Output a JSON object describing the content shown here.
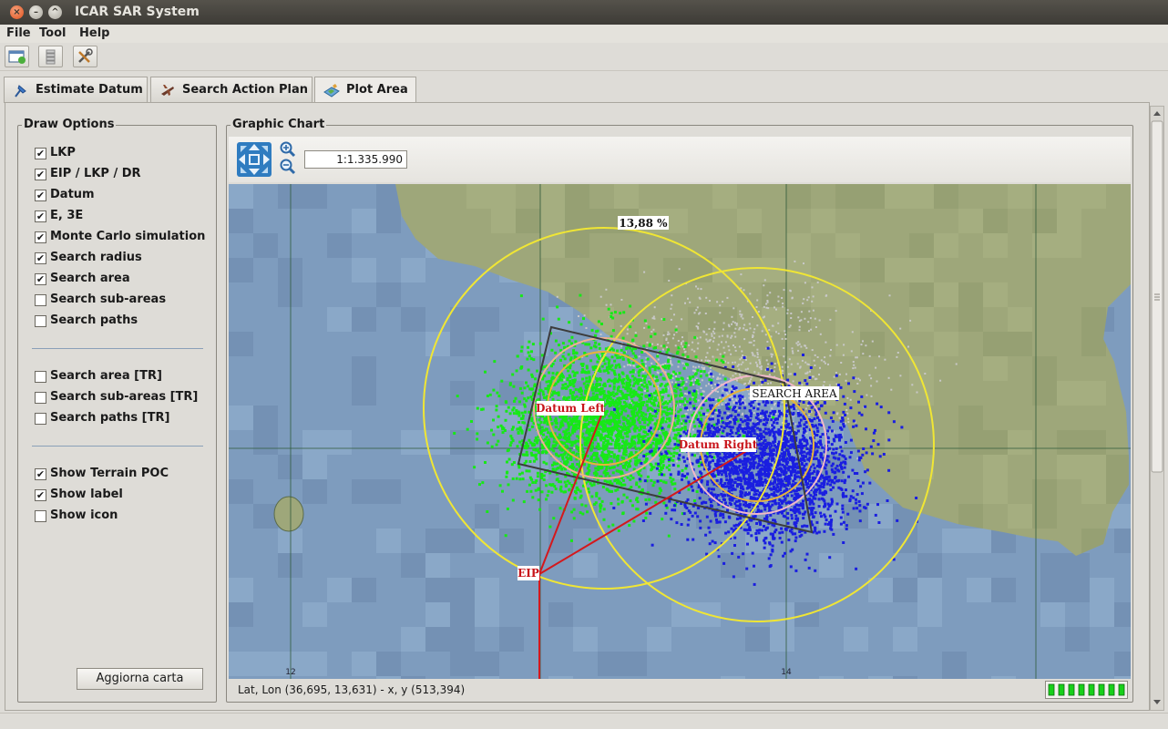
{
  "window": {
    "title": "ICAR SAR System"
  },
  "menu": [
    "File",
    "Tool",
    "Help"
  ],
  "tabs": [
    {
      "label": "Estimate Datum",
      "icon": "pin-icon"
    },
    {
      "label": "Search Action Plan",
      "icon": "aircraft-icon"
    },
    {
      "label": "Plot Area",
      "icon": "map-icon"
    }
  ],
  "draw_options": {
    "title": "Draw Options",
    "group1": [
      {
        "label": "LKP",
        "checked": true
      },
      {
        "label": "EIP / LKP / DR",
        "checked": true
      },
      {
        "label": "Datum",
        "checked": true
      },
      {
        "label": "E, 3E",
        "checked": true
      },
      {
        "label": "Monte Carlo simulation",
        "checked": true
      },
      {
        "label": "Search radius",
        "checked": true
      },
      {
        "label": "Search area",
        "checked": true
      },
      {
        "label": "Search sub-areas",
        "checked": false
      },
      {
        "label": "Search paths",
        "checked": false
      }
    ],
    "group2": [
      {
        "label": "Search area [TR]",
        "checked": false
      },
      {
        "label": "Search sub-areas [TR]",
        "checked": false
      },
      {
        "label": "Search paths [TR]",
        "checked": false
      }
    ],
    "group3": [
      {
        "label": "Show Terrain POC",
        "checked": true
      },
      {
        "label": "Show label",
        "checked": true
      },
      {
        "label": "Show icon",
        "checked": false
      }
    ],
    "refresh_button": "Aggiorna carta"
  },
  "chart": {
    "title": "Graphic Chart",
    "scale": "1:1.335.990",
    "labels": {
      "percent": "13,88 %",
      "search_area": "SEARCH AREA",
      "datum_left": "Datum Left",
      "datum_right": "Datum Right",
      "eip": "EIP",
      "lon_12": "12",
      "lon_14": "14"
    },
    "coords": "Lat, Lon (36,695, 13,631) - x, y (513,394)",
    "colors": {
      "sea": "#7e9cbe",
      "land": "#9ea77a",
      "datum_left_points": "#17e817",
      "datum_right_points": "#1a1ee0",
      "terrain_points": "#c8c8c8",
      "radius": "#f0e634",
      "vector": "#d4181c"
    }
  }
}
